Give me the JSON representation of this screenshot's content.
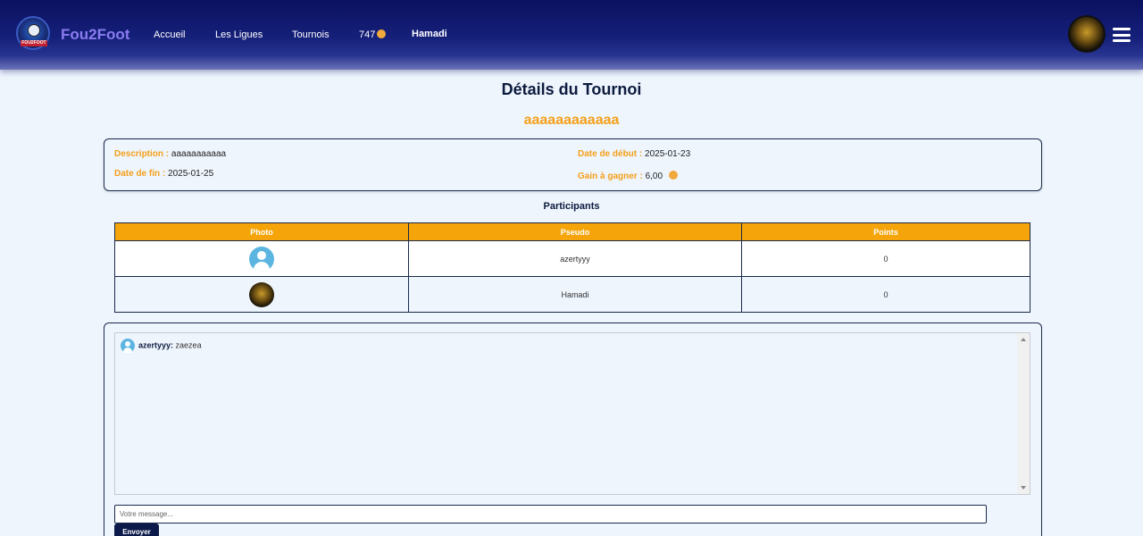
{
  "header": {
    "brand": "Fou2Foot",
    "logo_text": "FOU2FOOT",
    "nav": [
      "Accueil",
      "Les Ligues",
      "Tournois"
    ],
    "coins": "747",
    "username": "Hamadi"
  },
  "page": {
    "title": "Détails du Tournoi",
    "tournament_name": "aaaaaaaaaaaa"
  },
  "info": {
    "description_label": "Description :",
    "description_value": "aaaaaaaaaaa",
    "start_label": "Date de début :",
    "start_value": "2025-01-23",
    "end_label": "Date de fin :",
    "end_value": "2025-01-25",
    "prize_label": "Gain à gagner :",
    "prize_value": "6,00"
  },
  "participants": {
    "title": "Participants",
    "columns": [
      "Photo",
      "Pseudo",
      "Points"
    ],
    "rows": [
      {
        "pseudo": "azertyyy",
        "points": "0"
      },
      {
        "pseudo": "Hamadi",
        "points": "0"
      }
    ]
  },
  "chat": {
    "messages": [
      {
        "author": "azertyyy:",
        "text": "zaezea"
      }
    ],
    "input_placeholder": "Votre message...",
    "send_label": "Envoyer"
  },
  "colors": {
    "header_bg": "#0b1160",
    "accent": "#f5a01a",
    "brand": "#8a7cf0",
    "page_bg": "#eef5fd"
  }
}
